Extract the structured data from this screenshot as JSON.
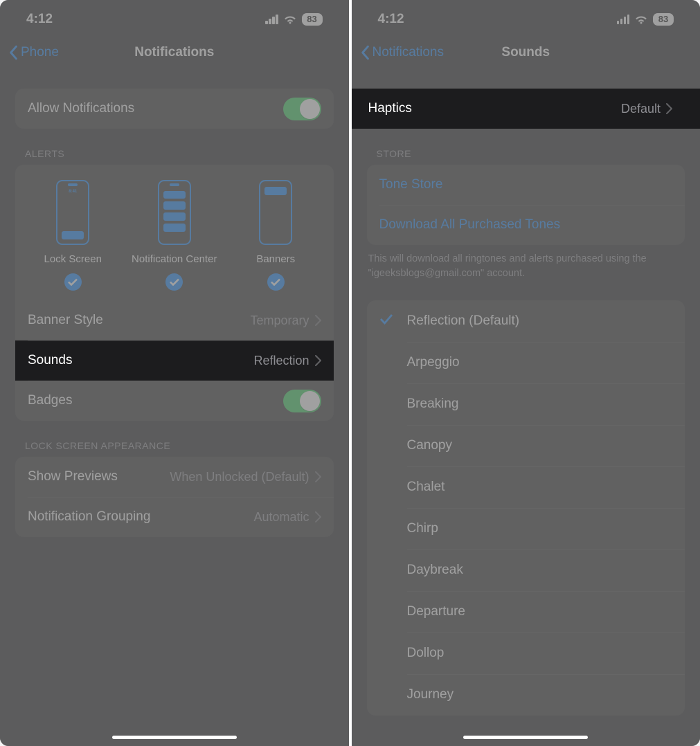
{
  "status": {
    "time": "4:12",
    "battery": "83"
  },
  "left": {
    "back_label": "Phone",
    "title": "Notifications",
    "allow_label": "Allow Notifications",
    "alerts_header": "ALERTS",
    "alert_options": {
      "lock": "Lock Screen",
      "center": "Notification Center",
      "banners": "Banners",
      "mini_time": "8:41"
    },
    "banner_style": {
      "label": "Banner Style",
      "value": "Temporary"
    },
    "sounds": {
      "label": "Sounds",
      "value": "Reflection"
    },
    "badges_label": "Badges",
    "lock_appearance_header": "LOCK SCREEN APPEARANCE",
    "previews": {
      "label": "Show Previews",
      "value": "When Unlocked (Default)"
    },
    "grouping": {
      "label": "Notification Grouping",
      "value": "Automatic"
    }
  },
  "right": {
    "back_label": "Notifications",
    "title": "Sounds",
    "haptics": {
      "label": "Haptics",
      "value": "Default"
    },
    "store_header": "STORE",
    "tone_store": "Tone Store",
    "download_all": "Download All Purchased Tones",
    "store_footer": "This will download all ringtones and alerts purchased using the \"igeeksblogs@gmail.com\" account.",
    "tones": [
      "Reflection (Default)",
      "Arpeggio",
      "Breaking",
      "Canopy",
      "Chalet",
      "Chirp",
      "Daybreak",
      "Departure",
      "Dollop",
      "Journey"
    ],
    "selected_index": 0
  }
}
